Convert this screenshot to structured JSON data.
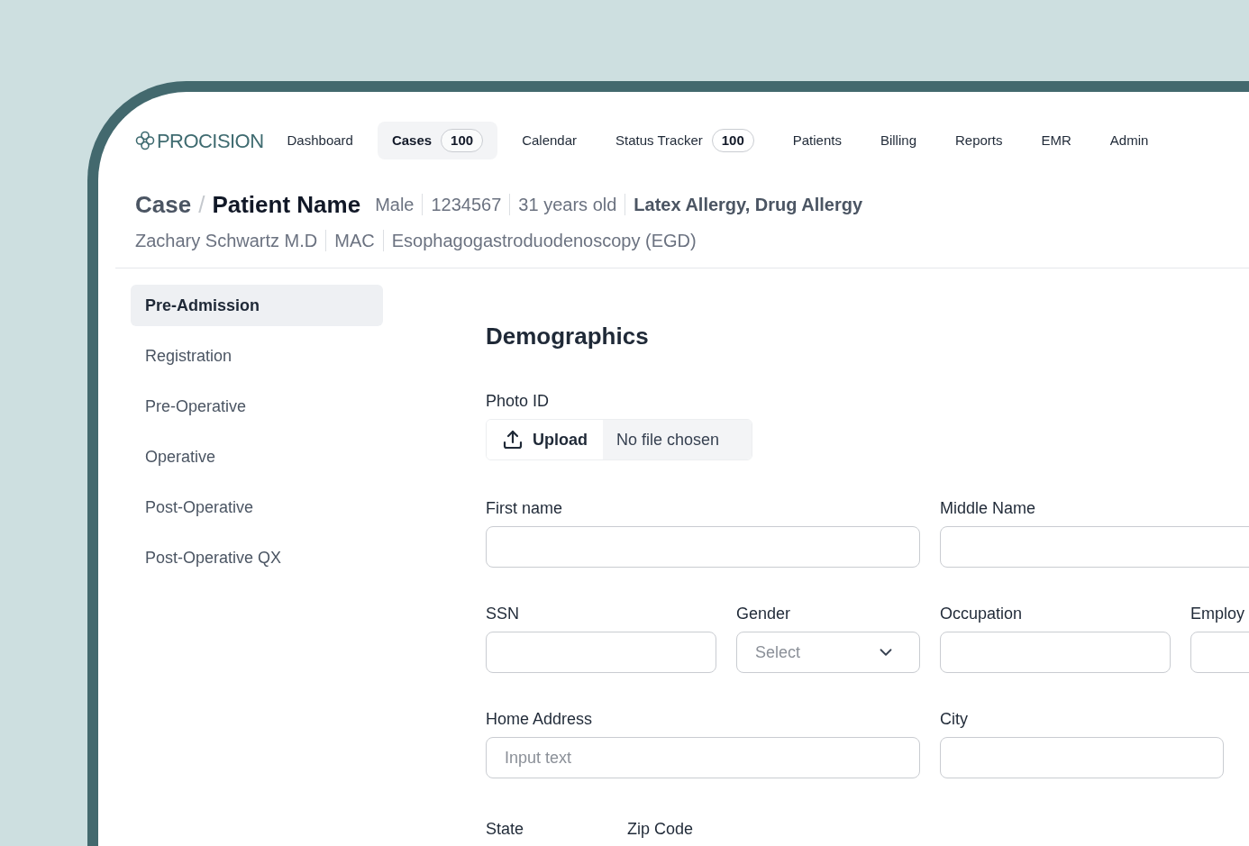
{
  "brand": "PROCISION",
  "nav": [
    {
      "label": "Dashboard",
      "selected": false
    },
    {
      "label": "Cases",
      "badge": "100",
      "selected": true
    },
    {
      "label": "Calendar",
      "selected": false
    },
    {
      "label": "Status Tracker",
      "badge": "100",
      "selected": false
    },
    {
      "label": "Patients",
      "selected": false
    },
    {
      "label": "Billing",
      "selected": false
    },
    {
      "label": "Reports",
      "selected": false
    },
    {
      "label": "EMR",
      "selected": false
    },
    {
      "label": "Admin",
      "selected": false
    }
  ],
  "header": {
    "section": "Case",
    "separator": "/",
    "title": "Patient Name",
    "meta": [
      "Male",
      "1234567",
      "31 years old"
    ],
    "allergies": "Latex Allergy, Drug Allergy",
    "details": [
      "Zachary Schwartz M.D",
      "MAC",
      "Esophagogastroduodenoscopy (EGD)"
    ]
  },
  "steps": [
    {
      "label": "Pre-Admission",
      "selected": true
    },
    {
      "label": "Registration",
      "selected": false
    },
    {
      "label": "Pre-Operative",
      "selected": false
    },
    {
      "label": "Operative",
      "selected": false
    },
    {
      "label": "Post-Operative",
      "selected": false
    },
    {
      "label": "Post-Operative QX",
      "selected": false
    }
  ],
  "form": {
    "title": "Demographics",
    "photo_id": {
      "label": "Photo ID",
      "button": "Upload",
      "status": "No file chosen"
    },
    "rows": [
      [
        {
          "label": "First name",
          "kind": "text"
        },
        {
          "label": "Middle Name",
          "kind": "text"
        }
      ],
      [
        {
          "label": "SSN",
          "kind": "text"
        },
        {
          "label": "Gender",
          "kind": "select",
          "placeholder": "Select"
        },
        {
          "label": "Occupation",
          "kind": "text"
        },
        {
          "label": "Employ",
          "kind": "text"
        }
      ],
      [
        {
          "label": "Home Address",
          "kind": "text",
          "placeholder": "Input text"
        },
        {
          "label": "City",
          "kind": "text"
        }
      ],
      [
        {
          "label": "State",
          "kind": "label"
        },
        {
          "label": "Zip Code",
          "kind": "label"
        }
      ]
    ]
  }
}
